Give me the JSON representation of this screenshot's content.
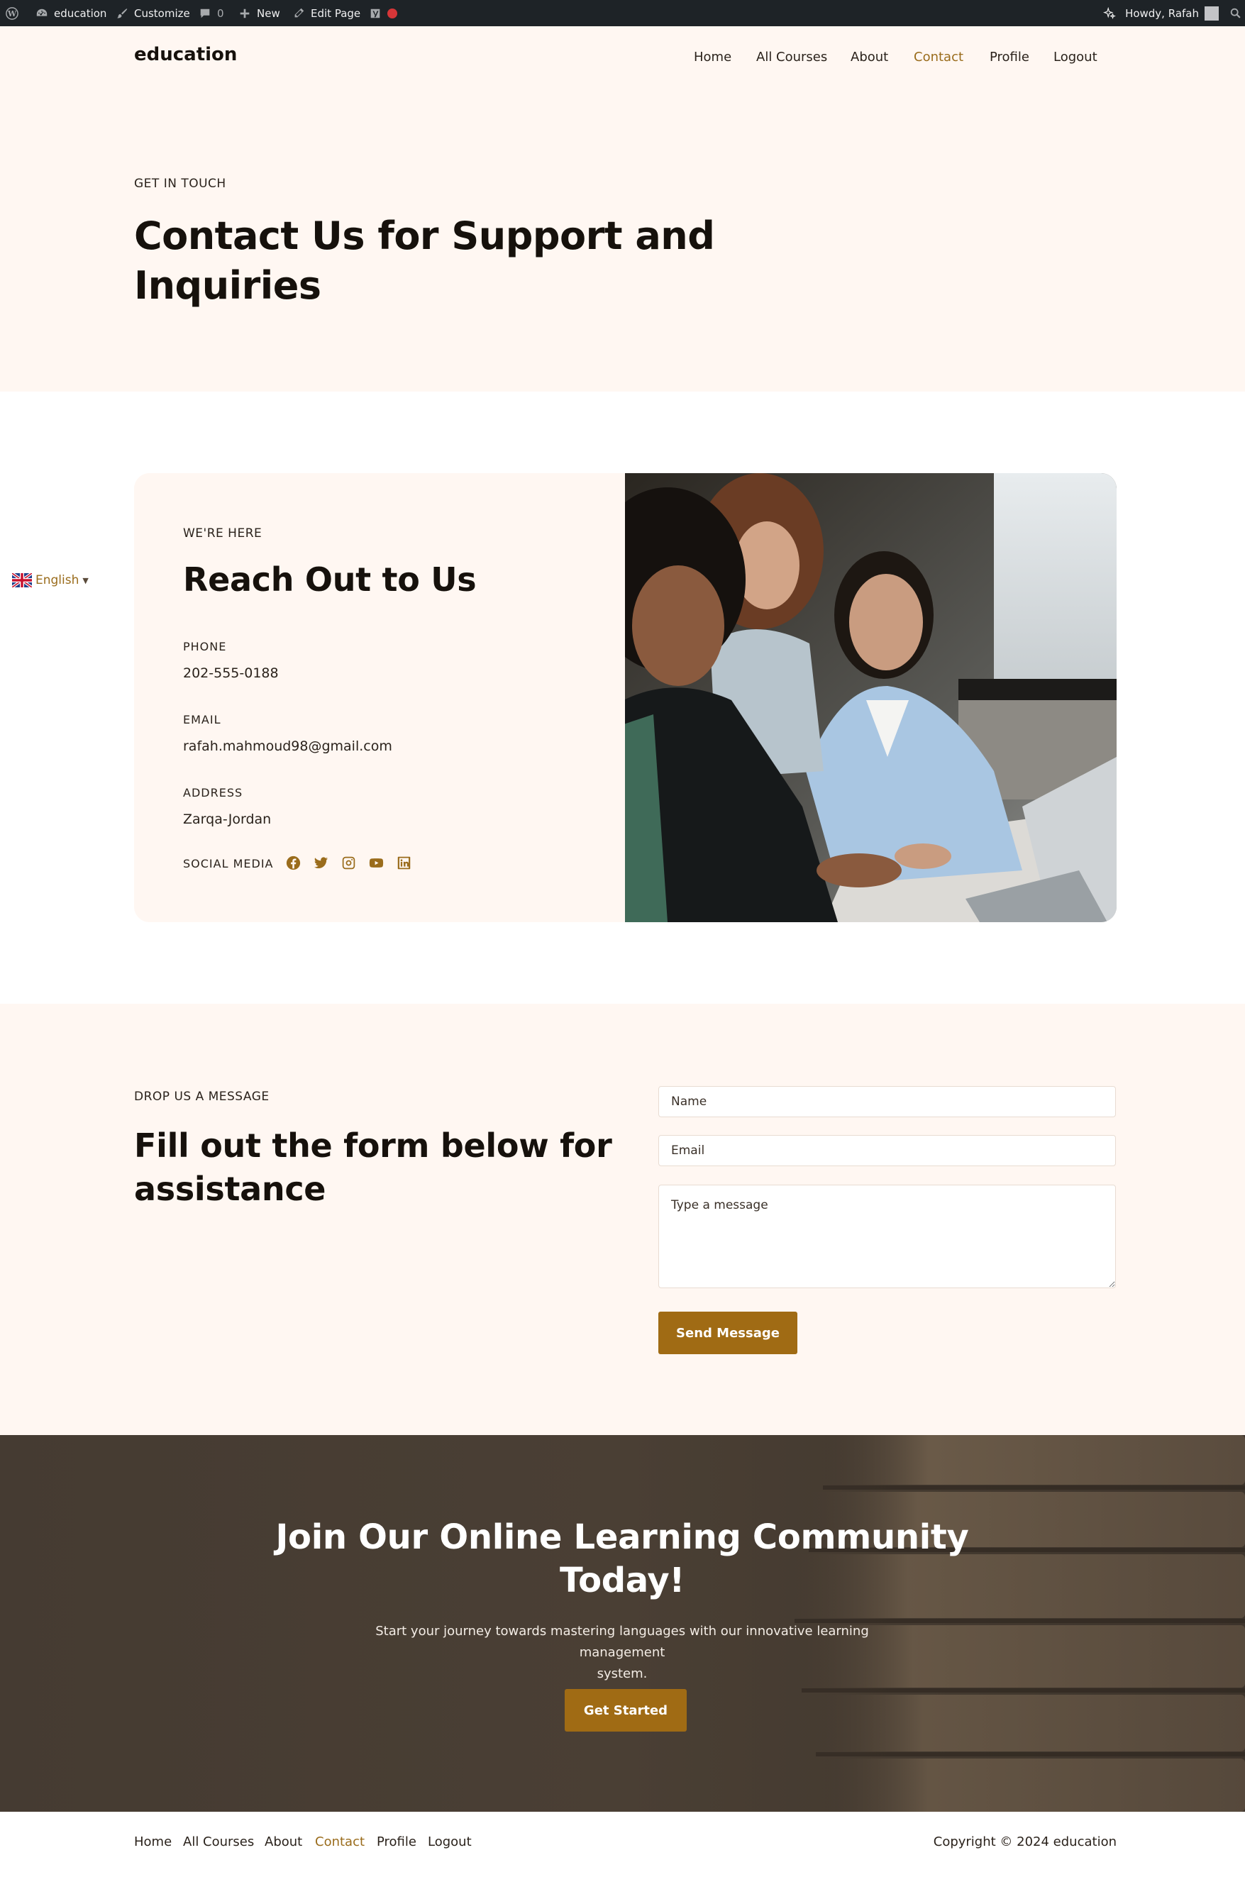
{
  "admin_bar": {
    "site_name": "education",
    "customize": "Customize",
    "comments_count": "0",
    "new": "New",
    "edit_page": "Edit Page",
    "howdy": "Howdy, Rafah"
  },
  "header": {
    "logo": "education",
    "nav": [
      "Home",
      "All Courses",
      "About",
      "Contact",
      "Profile",
      "Logout"
    ],
    "active_nav": "Contact"
  },
  "hero": {
    "eyebrow": "GET IN TOUCH",
    "title_line1": "Contact Us for Support and",
    "title_line2": "Inquiries"
  },
  "reach": {
    "eyebrow": "WE'RE HERE",
    "title": "Reach Out to Us",
    "phone_label": "PHONE",
    "phone": "202-555-0188",
    "email_label": "EMAIL",
    "email": "rafah.mahmoud98@gmail.com",
    "address_label": "ADDRESS",
    "address": "Zarqa-Jordan",
    "social_label": "SOCIAL MEDIA",
    "social_icons": [
      "facebook-icon",
      "twitter-icon",
      "instagram-icon",
      "youtube-icon",
      "linkedin-icon"
    ]
  },
  "language": {
    "label": "English"
  },
  "message": {
    "eyebrow": "DROP US A MESSAGE",
    "title_line1": "Fill out the form below for",
    "title_line2": "assistance",
    "name_placeholder": "Name",
    "email_placeholder": "Email",
    "message_placeholder": "Type a message",
    "send_label": "Send Message"
  },
  "cta": {
    "title_line1": "Join Our Online Learning Community",
    "title_line2": "Today!",
    "subtitle_line1": "Start your journey towards mastering languages with our innovative learning management",
    "subtitle_line2": "system.",
    "button": "Get Started"
  },
  "footer": {
    "nav": [
      "Home",
      "All Courses",
      "About",
      "Contact",
      "Profile",
      "Logout"
    ],
    "copyright": "Copyright © 2024 education"
  },
  "colors": {
    "accent": "#a06b14",
    "cream": "#fff7f2",
    "admin_bar": "#1e2327",
    "dark_text": "#16110c"
  }
}
